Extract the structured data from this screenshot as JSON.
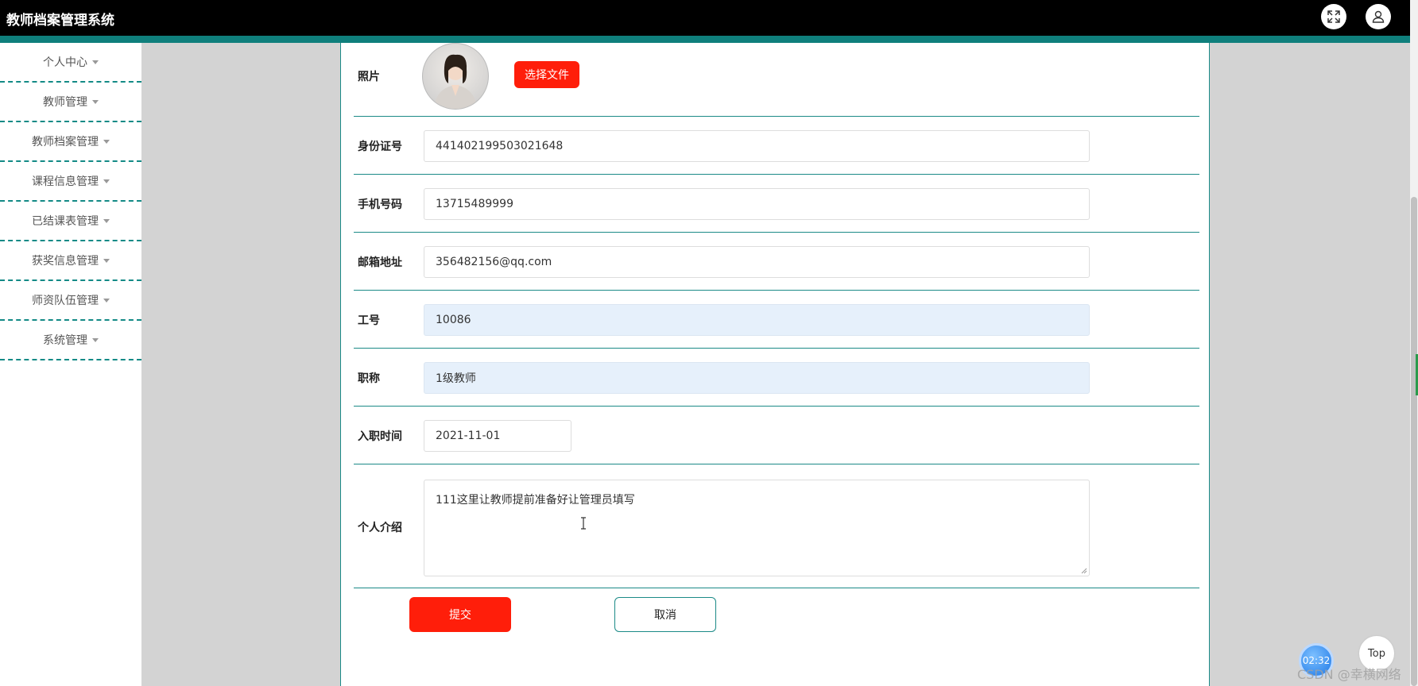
{
  "header": {
    "title": "教师档案管理系统"
  },
  "sidebar": {
    "items": [
      {
        "label": "个人中心"
      },
      {
        "label": "教师管理"
      },
      {
        "label": "教师档案管理"
      },
      {
        "label": "课程信息管理"
      },
      {
        "label": "已结课表管理"
      },
      {
        "label": "获奖信息管理"
      },
      {
        "label": "师资队伍管理"
      },
      {
        "label": "系统管理"
      }
    ]
  },
  "form": {
    "photo": {
      "label": "照片",
      "button": "选择文件"
    },
    "id_card": {
      "label": "身份证号",
      "value": "441402199503021648"
    },
    "phone": {
      "label": "手机号码",
      "value": "13715489999"
    },
    "email": {
      "label": "邮箱地址",
      "value": "356482156@qq.com"
    },
    "staff_no": {
      "label": "工号",
      "value": "10086"
    },
    "title": {
      "label": "职称",
      "value": "1级教师"
    },
    "hire_date": {
      "label": "入职时间",
      "value": "2021-11-01"
    },
    "intro": {
      "label": "个人介绍",
      "value": "111这里让教师提前准备好让管理员填写"
    },
    "submit": "提交",
    "cancel": "取消"
  },
  "overlay": {
    "timer": "02:32",
    "top_button": "Top",
    "watermark": "CSDN @幸横网络"
  },
  "colors": {
    "accent_teal": "#0f7f7c",
    "button_red": "#ff1e0a",
    "readonly_fill": "#e6f0fb"
  },
  "icons": [
    "fullscreen-icon",
    "user-icon",
    "caret-down-icon",
    "text-cursor-icon"
  ]
}
